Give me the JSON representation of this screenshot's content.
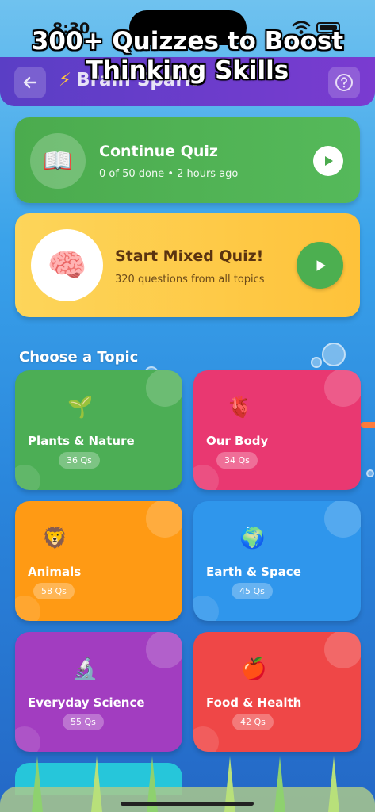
{
  "status_bar": {
    "time": "8:30"
  },
  "promo": {
    "line1": "300+ Quizzes to Boost",
    "line2": "Thinking Skills"
  },
  "header": {
    "title": "Brain Spark",
    "back_icon": "back-arrow-icon",
    "help_icon": "help-icon"
  },
  "continue_card": {
    "icon": "📖",
    "title": "Continue Quiz",
    "subtitle": "0 of 50 done • 2 hours ago"
  },
  "mixed_card": {
    "icon": "🧠",
    "title": "Start Mixed Quiz!",
    "subtitle": "320 questions from all topics"
  },
  "section": {
    "title": "Choose a Topic"
  },
  "topics": [
    {
      "icon": "🌱",
      "label": "Plants & Nature",
      "count": "36 Qs",
      "color": "#4cae55"
    },
    {
      "icon": "🫀",
      "label": "Our Body",
      "count": "34 Qs",
      "color": "#e93871"
    },
    {
      "icon": "🦁",
      "label": "Animals",
      "count": "58 Qs",
      "color": "#ff9a14"
    },
    {
      "icon": "🌍",
      "label": "Earth & Space",
      "count": "45 Qs",
      "color": "#2f96ec"
    },
    {
      "icon": "🔬",
      "label": "Everyday Science",
      "count": "55 Qs",
      "color": "#a23dc0"
    },
    {
      "icon": "🍎",
      "label": "Food & Health",
      "count": "42 Qs",
      "color": "#ef4747"
    }
  ]
}
